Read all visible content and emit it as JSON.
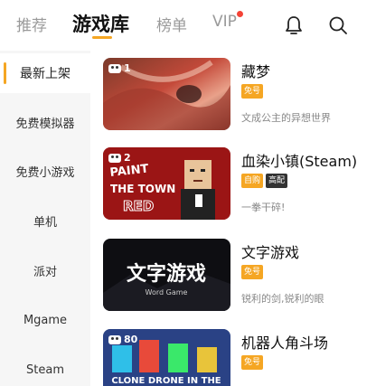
{
  "tabs": [
    {
      "label": "推荐",
      "active": false
    },
    {
      "label": "游戏库",
      "active": true
    },
    {
      "label": "榜单",
      "active": false
    },
    {
      "label": "VIP",
      "active": false
    }
  ],
  "top_icons": [
    "bell-icon",
    "search-icon"
  ],
  "accent_color": "#f5a623",
  "sidebar": {
    "items": [
      {
        "label": "最新上架",
        "active": true
      },
      {
        "label": "免费模拟器",
        "active": false
      },
      {
        "label": "免费小游戏",
        "active": false
      },
      {
        "label": "单机",
        "active": false
      },
      {
        "label": "派对",
        "active": false
      },
      {
        "label": "Mgame",
        "active": false
      },
      {
        "label": "Steam",
        "active": false
      }
    ]
  },
  "games": [
    {
      "title": "藏梦",
      "count": "1",
      "tags": [
        "免号"
      ],
      "desc": "文成公主的异想世界",
      "thumb_text": ""
    },
    {
      "title": "血染小镇(Steam)",
      "count": "2",
      "tags": [
        "自购",
        "高配"
      ],
      "desc": "一拳干碎!",
      "thumb_text": "PAINT THE TOWN RED"
    },
    {
      "title": "文字游戏",
      "count": "",
      "tags": [
        "免号"
      ],
      "desc": "锐利的剑,锐利的眼",
      "thumb_text": "文字游戏",
      "thumb_sub": "Word Game"
    },
    {
      "title": "机器人角斗场",
      "count": "80",
      "tags": [
        "免号"
      ],
      "desc": "",
      "thumb_text": "CLONE DRONE IN THE"
    }
  ]
}
